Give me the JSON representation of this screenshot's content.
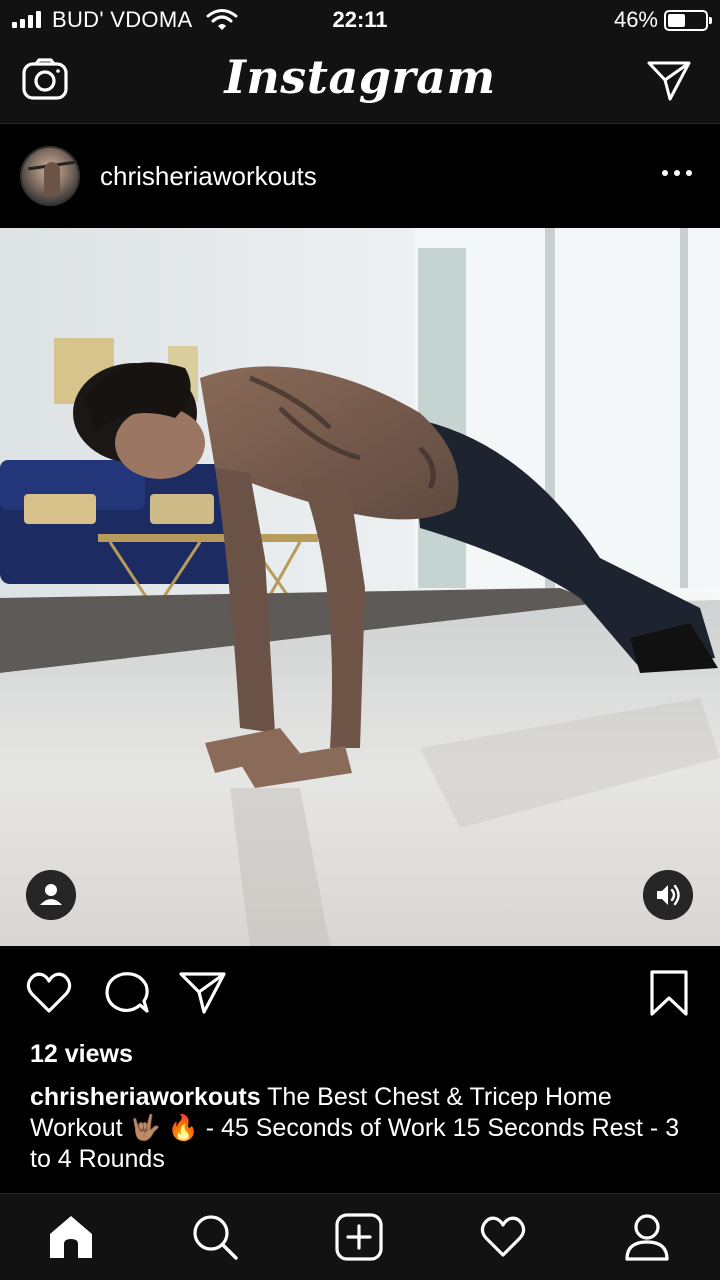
{
  "status_bar": {
    "carrier": "BUD' VDOMA",
    "time": "22:11",
    "battery_percent": "46%",
    "battery_level": 0.46,
    "signal_bars": 4,
    "icons": [
      "signal-icon",
      "wifi-icon",
      "battery-icon"
    ]
  },
  "nav": {
    "brand": "Instagram",
    "left_icon": "camera-icon",
    "right_icon": "direct-message-icon"
  },
  "post": {
    "username": "chrisheriaworkouts",
    "more_icon": "more-options-icon",
    "media_controls": [
      "tag-people-icon",
      "sound-icon"
    ],
    "actions": [
      "heart-icon",
      "comment-icon",
      "share-icon",
      "bookmark-icon"
    ],
    "views": "12 views",
    "caption_user": "chrisheriaworkouts",
    "caption_text": "The Best Chest & Tricep Home Workout 🤟🏽 🔥  - 45 Seconds of Work 15 Seconds Rest - 3 to 4 Rounds"
  },
  "tabbar": {
    "items": [
      "home-icon",
      "search-icon",
      "add-post-icon",
      "activity-heart-icon",
      "profile-icon"
    ],
    "active": "home-icon"
  },
  "colors": {
    "background": "#000000",
    "bar_background": "#121212",
    "text": "#ffffff",
    "overlay_button": "#262626"
  }
}
